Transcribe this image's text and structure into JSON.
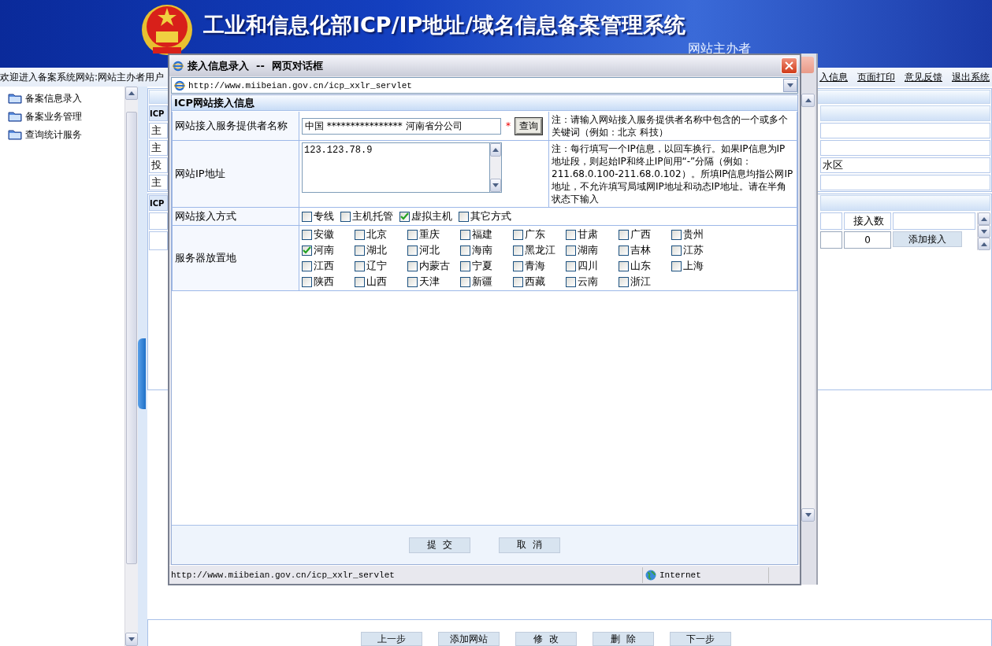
{
  "header": {
    "title": "工业和信息化部ICP/IP地址/域名信息备案管理系统",
    "subtitle": "网站主办者"
  },
  "nav": {
    "welcome": "欢迎进入备案系统网站:网站主办者用户",
    "links": [
      "入信息",
      "页面打印",
      "意见反馈",
      "退出系统"
    ]
  },
  "sidebar": {
    "items": [
      "备案信息录入",
      "备案业务管理",
      "查询统计服务"
    ]
  },
  "main": {
    "panel_1": {
      "header": "ICP",
      "rows": [
        {
          "label": "主"
        },
        {
          "label": "主"
        },
        {
          "label": "投",
          "value": "水区"
        },
        {
          "label": "主"
        }
      ]
    },
    "panel_2": {
      "header": "ICP",
      "columns": [
        "接入数"
      ],
      "count": "0",
      "button": "添加接入"
    },
    "bottom_buttons": [
      "上一步",
      "添加网站",
      "修  改",
      "删  除",
      "下一步"
    ]
  },
  "dialog": {
    "title": "接入信息录入  --  网页对话框",
    "address": "http://www.miibeian.gov.cn/icp_xxlr_servlet",
    "section": "ICP网站接入信息",
    "provider": {
      "label": "网站接入服务提供者名称",
      "value": "中国 **************** 河南省分公司",
      "required": "*",
      "button": "查询",
      "note": "注：请输入网站接入服务提供者名称中包含的一个或多个关键词（例如：北京 科技）"
    },
    "ip": {
      "label": "网站IP地址",
      "value": "123.123.78.9",
      "note": "注：每行填写一个IP信息，以回车换行。如果IP信息为IP地址段，则起始IP和终止IP间用“-”分隔（例如：211.68.0.100-211.68.0.102）。所填IP信息均指公网IP地址，不允许填写局域网IP地址和动态IP地址。请在半角状态下输入"
    },
    "access": {
      "label": "网站接入方式",
      "options": [
        {
          "label": "专线",
          "checked": false
        },
        {
          "label": "主机托管",
          "checked": false
        },
        {
          "label": "虚拟主机",
          "checked": true
        },
        {
          "label": "其它方式",
          "checked": false
        }
      ]
    },
    "location": {
      "label": "服务器放置地",
      "options": [
        {
          "label": "安徽",
          "checked": false
        },
        {
          "label": "北京",
          "checked": false
        },
        {
          "label": "重庆",
          "checked": false
        },
        {
          "label": "福建",
          "checked": false
        },
        {
          "label": "广东",
          "checked": false
        },
        {
          "label": "甘肃",
          "checked": false
        },
        {
          "label": "广西",
          "checked": false
        },
        {
          "label": "贵州",
          "checked": false
        },
        {
          "label": "河南",
          "checked": true
        },
        {
          "label": "湖北",
          "checked": false
        },
        {
          "label": "河北",
          "checked": false
        },
        {
          "label": "海南",
          "checked": false
        },
        {
          "label": "黑龙江",
          "checked": false
        },
        {
          "label": "湖南",
          "checked": false
        },
        {
          "label": "吉林",
          "checked": false
        },
        {
          "label": "江苏",
          "checked": false
        },
        {
          "label": "江西",
          "checked": false
        },
        {
          "label": "辽宁",
          "checked": false
        },
        {
          "label": "内蒙古",
          "checked": false
        },
        {
          "label": "宁夏",
          "checked": false
        },
        {
          "label": "青海",
          "checked": false
        },
        {
          "label": "四川",
          "checked": false
        },
        {
          "label": "山东",
          "checked": false
        },
        {
          "label": "上海",
          "checked": false
        },
        {
          "label": "陕西",
          "checked": false
        },
        {
          "label": "山西",
          "checked": false
        },
        {
          "label": "天津",
          "checked": false
        },
        {
          "label": "新疆",
          "checked": false
        },
        {
          "label": "西藏",
          "checked": false
        },
        {
          "label": "云南",
          "checked": false
        },
        {
          "label": "浙江",
          "checked": false
        }
      ]
    },
    "buttons": [
      "提  交",
      "取  消"
    ],
    "status": {
      "url": "http://www.miibeian.gov.cn/icp_xxlr_servlet",
      "zone": "Internet"
    }
  }
}
